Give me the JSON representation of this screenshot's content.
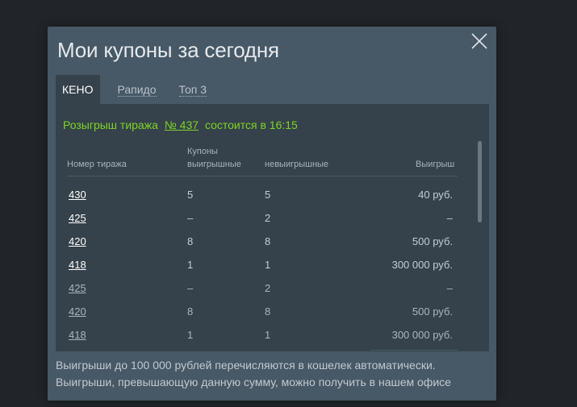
{
  "modal": {
    "title": "Мои купоны за сегодня",
    "close_icon": "close-icon"
  },
  "tabs": [
    {
      "label": "КЕНО",
      "active": true
    },
    {
      "label": "Рапидо",
      "active": false
    },
    {
      "label": "Топ 3",
      "active": false
    }
  ],
  "draw_info": {
    "prefix": "Розыгрыш тиража",
    "draw_number": "№ 437",
    "suffix": "состоится в 16:15"
  },
  "table": {
    "headers": {
      "draw_number": "Номер тиража",
      "coupons_line1": "Купоны",
      "coupons_line2": "выигрышные",
      "losing": "невыигрышные",
      "winnings": "Выигрыш"
    },
    "rows": [
      {
        "draw": "430",
        "winning": "5",
        "losing": "5",
        "prize": "40 руб."
      },
      {
        "draw": "425",
        "winning": "–",
        "losing": "2",
        "prize": "–"
      },
      {
        "draw": "420",
        "winning": "8",
        "losing": "8",
        "prize": "500 руб."
      },
      {
        "draw": "418",
        "winning": "1",
        "losing": "1",
        "prize": "300 000 руб."
      },
      {
        "draw": "425",
        "winning": "–",
        "losing": "2",
        "prize": "–"
      },
      {
        "draw": "420",
        "winning": "8",
        "losing": "8",
        "prize": "500 руб."
      },
      {
        "draw": "418",
        "winning": "1",
        "losing": "1",
        "prize": "300 000 руб."
      }
    ]
  },
  "footer": {
    "line1": "Выигрыши до 100 000 рублей перечисляются в кошелек автоматически.",
    "line2": "Выигрыши, превышающую данную сумму, можно получить в нашем офисе"
  },
  "colors": {
    "background": "#212529",
    "modal": "#475866",
    "panel": "#35424c",
    "accent_green": "#7ed321"
  }
}
